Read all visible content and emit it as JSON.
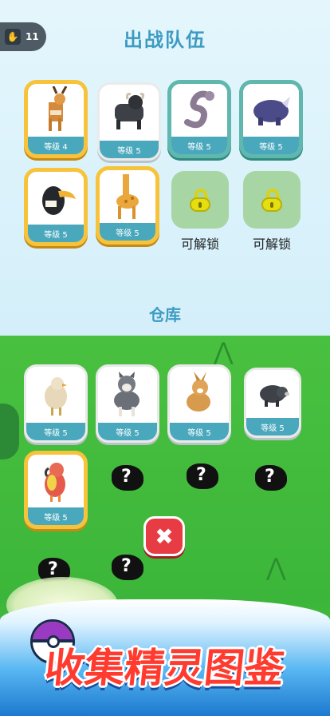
{
  "counter": {
    "icon": "paw-icon",
    "value": "11"
  },
  "team": {
    "title": "出战队伍",
    "cards": [
      {
        "animal": "deer",
        "level": "等级 4"
      },
      {
        "animal": "buffalo",
        "level": "等级 5"
      },
      {
        "animal": "snake",
        "level": "等级 5"
      },
      {
        "animal": "rhino",
        "level": "等级 5"
      },
      {
        "animal": "toucan",
        "level": "等级 5"
      },
      {
        "animal": "giraffe",
        "level": "等级 5"
      }
    ],
    "locked_slots": [
      {
        "label": "可解锁"
      },
      {
        "label": "可解锁"
      }
    ]
  },
  "warehouse": {
    "title": "仓库",
    "cards": [
      {
        "animal": "chicken",
        "level": "等级 5"
      },
      {
        "animal": "husky",
        "level": "等级 5"
      },
      {
        "animal": "rabbit",
        "level": "等级 5"
      },
      {
        "animal": "boar",
        "level": "等级 5"
      },
      {
        "animal": "parrot",
        "level": "等级 5"
      }
    ],
    "unknown_mark": "?"
  },
  "close_label": "✖",
  "banner": {
    "slogan": "收集精灵图鉴"
  }
}
